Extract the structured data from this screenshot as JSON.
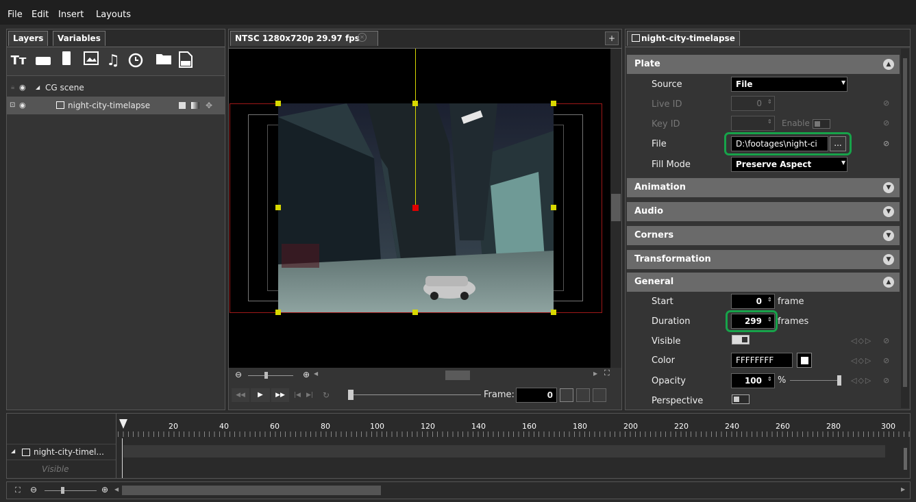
{
  "menu": [
    "File",
    "Edit",
    "Insert",
    "Layouts"
  ],
  "left_panel": {
    "tabs": [
      "Layers",
      "Variables"
    ],
    "tree": [
      {
        "label": "CG scene"
      },
      {
        "label": "night-city-timelapse"
      }
    ]
  },
  "viewport": {
    "tab_label": "NTSC 1280x720p 29.97 fps",
    "add_label": "+",
    "frame_label": "Frame:",
    "frame_value": "0"
  },
  "right_panel": {
    "tab_label": "night-city-timelapse",
    "sections": {
      "plate": "Plate",
      "animation": "Animation",
      "audio": "Audio",
      "corners": "Corners",
      "transformation": "Transformation",
      "general": "General"
    },
    "plate": {
      "source_label": "Source",
      "source_value": "File",
      "live_id_label": "Live ID",
      "live_id_value": "0",
      "key_id_label": "Key ID",
      "enable_label": "Enable",
      "file_label": "File",
      "file_value": "D:\\footages\\night-ci",
      "browse_label": "...",
      "fill_mode_label": "Fill Mode",
      "fill_mode_value": "Preserve Aspect"
    },
    "general": {
      "start_label": "Start",
      "start_value": "0",
      "start_unit": "frame",
      "duration_label": "Duration",
      "duration_value": "299",
      "duration_unit": "frames",
      "visible_label": "Visible",
      "color_label": "Color",
      "color_value": "FFFFFFFF",
      "opacity_label": "Opacity",
      "opacity_value": "100",
      "opacity_unit": "%",
      "perspective_label": "Perspective"
    }
  },
  "timeline": {
    "ticks": [
      "20",
      "40",
      "60",
      "80",
      "100",
      "120",
      "140",
      "160",
      "180",
      "200",
      "220",
      "240",
      "260",
      "280",
      "300"
    ],
    "track_label": "night-city-timel...",
    "sub_label": "Visible"
  },
  "colors": {
    "highlight": "#17a34a",
    "handle": "#d8d800",
    "safe_area": "#a01818"
  }
}
